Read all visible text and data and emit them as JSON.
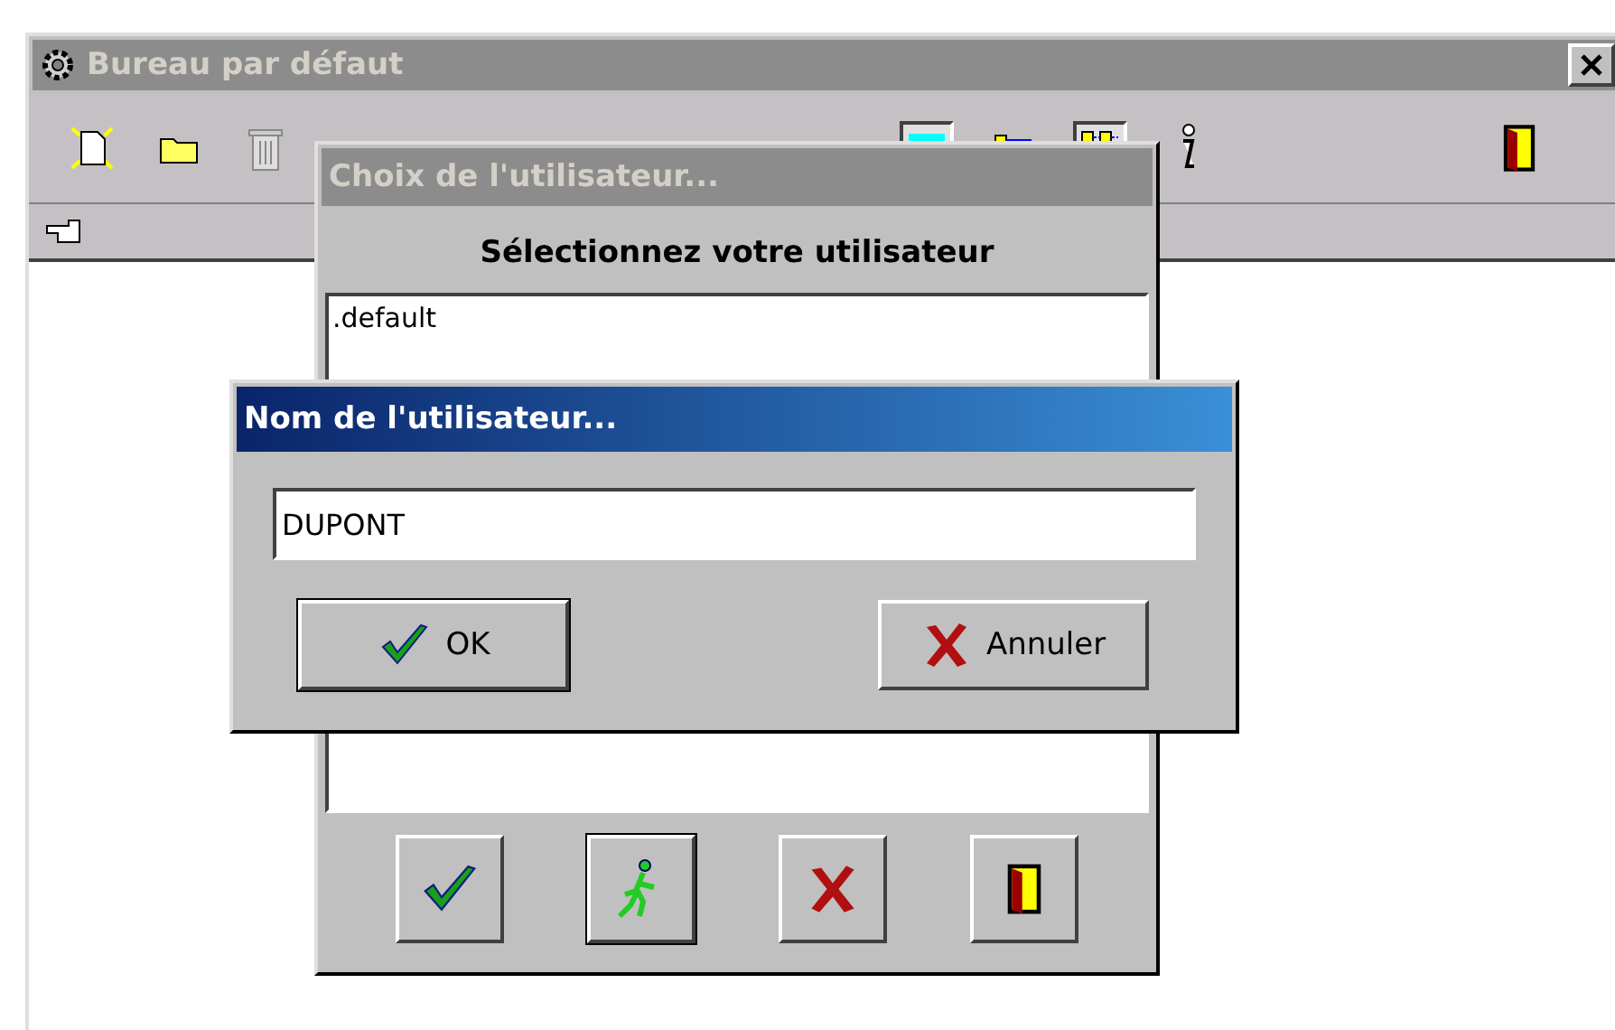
{
  "main_window": {
    "title": "Bureau par défaut",
    "active": false
  },
  "user_dialog": {
    "title": "Choix de l'utilisateur...",
    "active": false,
    "heading": "Sélectionnez votre utilisateur",
    "users": [
      {
        "name": ".default",
        "selected": false
      }
    ]
  },
  "name_dialog": {
    "title": "Nom de l'utilisateur...",
    "active": true,
    "value": "DUPONT",
    "ok": "OK",
    "cancel": "Annuler"
  }
}
